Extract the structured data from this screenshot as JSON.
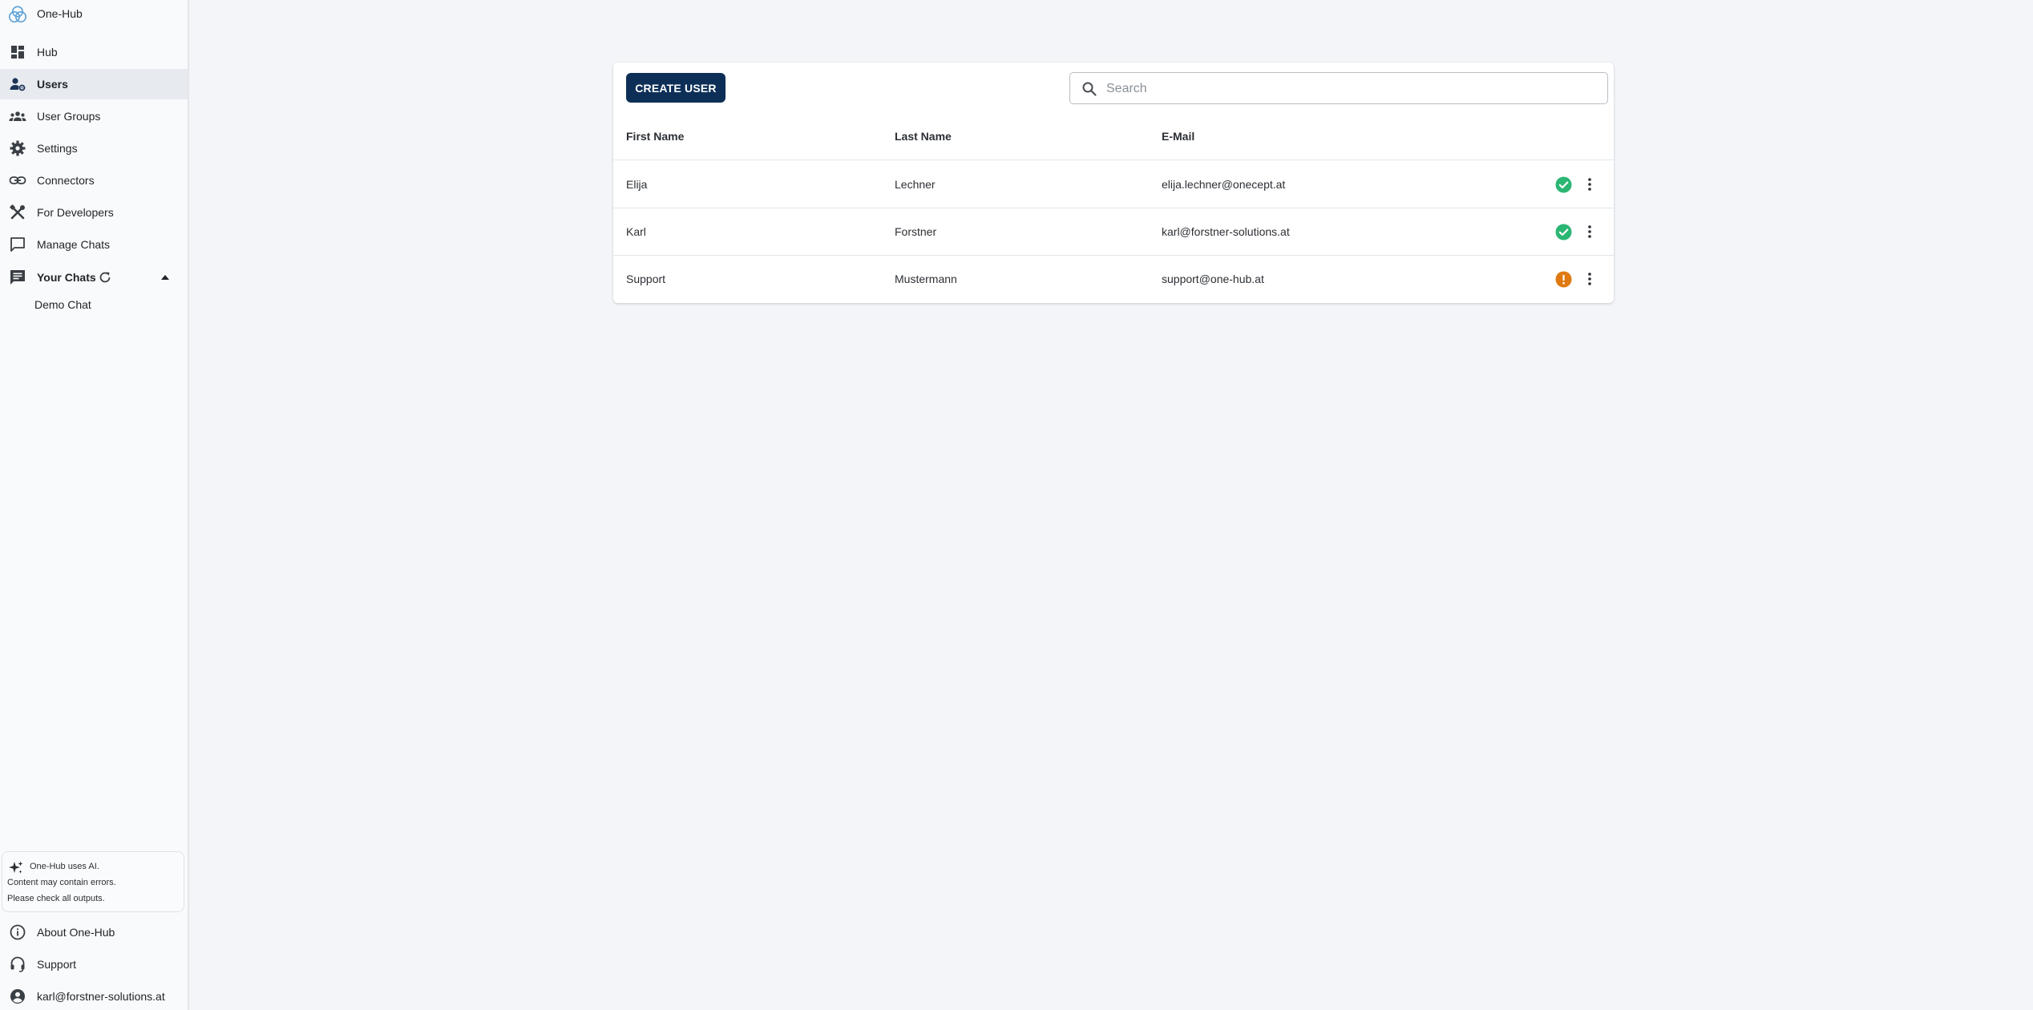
{
  "app": {
    "name": "One-Hub"
  },
  "sidebar": {
    "items": [
      {
        "label": "Hub",
        "icon": "dashboard-icon"
      },
      {
        "label": "Users",
        "icon": "manage-accounts-icon",
        "active": true
      },
      {
        "label": "User Groups",
        "icon": "groups-icon"
      },
      {
        "label": "Settings",
        "icon": "gear-icon"
      },
      {
        "label": "Connectors",
        "icon": "link-icon"
      },
      {
        "label": "For Developers",
        "icon": "tools-icon"
      },
      {
        "label": "Manage Chats",
        "icon": "chat-bubble-icon"
      }
    ],
    "your_chats": {
      "label": "Your Chats",
      "expanded": true,
      "items": [
        {
          "label": "Demo Chat"
        }
      ]
    },
    "ai_notice": {
      "line1": "One-Hub uses AI.",
      "line2": "Content may contain errors.",
      "line3": "Please check all outputs."
    },
    "footer": {
      "about": "About One-Hub",
      "support": "Support",
      "account": "karl@forstner-solutions.at"
    }
  },
  "toolbar": {
    "create_label": "CREATE USER",
    "search_placeholder": "Search",
    "search_value": ""
  },
  "table": {
    "columns": [
      "First Name",
      "Last Name",
      "E-Mail"
    ],
    "rows": [
      {
        "first": "Elija",
        "last": "Lechner",
        "email": "elija.lechner@onecept.at",
        "status": "verified"
      },
      {
        "first": "Karl",
        "last": "Forstner",
        "email": "karl@forstner-solutions.at",
        "status": "verified"
      },
      {
        "first": "Support",
        "last": "Mustermann",
        "email": "support@one-hub.at",
        "status": "warning"
      }
    ]
  },
  "colors": {
    "accent": "#0d2f57",
    "success": "#2bb673",
    "warning": "#e07a10",
    "active_bg": "#e7ebf0"
  }
}
